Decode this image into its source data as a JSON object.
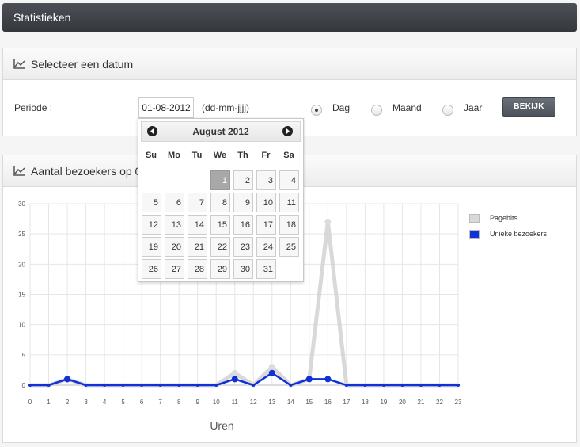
{
  "header": {
    "title": "Statistieken"
  },
  "date_panel": {
    "title": "Selecteer een datum",
    "period_label": "Periode :",
    "date_value": "01-08-2012",
    "date_format": "(dd-mm-jjjj)",
    "options": [
      {
        "label": "Dag",
        "selected": true
      },
      {
        "label": "Maand",
        "selected": false
      },
      {
        "label": "Jaar",
        "selected": false
      }
    ],
    "view_button": "BEKIJK"
  },
  "calendar": {
    "month_title": "August 2012",
    "weekdays": [
      "Su",
      "Mo",
      "Tu",
      "We",
      "Th",
      "Fr",
      "Sa"
    ],
    "first_weekday": 3,
    "days_in_month": 31,
    "selected_day": 1
  },
  "visitors_panel": {
    "title": "Aantal bezoekers op 01"
  },
  "chart_data": {
    "type": "line",
    "x": [
      0,
      1,
      2,
      3,
      4,
      5,
      6,
      7,
      8,
      9,
      10,
      11,
      12,
      13,
      14,
      15,
      16,
      17,
      18,
      19,
      20,
      21,
      22,
      23
    ],
    "xlabel": "Uren",
    "ylabel": "",
    "ylim": [
      0,
      30
    ],
    "yticks": [
      0,
      5,
      10,
      15,
      20,
      25,
      30
    ],
    "grid": true,
    "legend_position": "top-right",
    "series": [
      {
        "name": "Pagehits",
        "color": "#d9d9d9",
        "values": [
          0,
          0,
          1,
          0,
          0,
          0,
          0,
          0,
          0,
          0,
          0,
          2,
          0,
          3,
          0,
          1,
          27,
          0,
          0,
          0,
          0,
          0,
          0,
          0
        ]
      },
      {
        "name": "Unieke bezoekers",
        "color": "#1030d8",
        "values": [
          0,
          0,
          1,
          0,
          0,
          0,
          0,
          0,
          0,
          0,
          0,
          1,
          0,
          2,
          0,
          1,
          1,
          0,
          0,
          0,
          0,
          0,
          0,
          0
        ]
      }
    ]
  }
}
